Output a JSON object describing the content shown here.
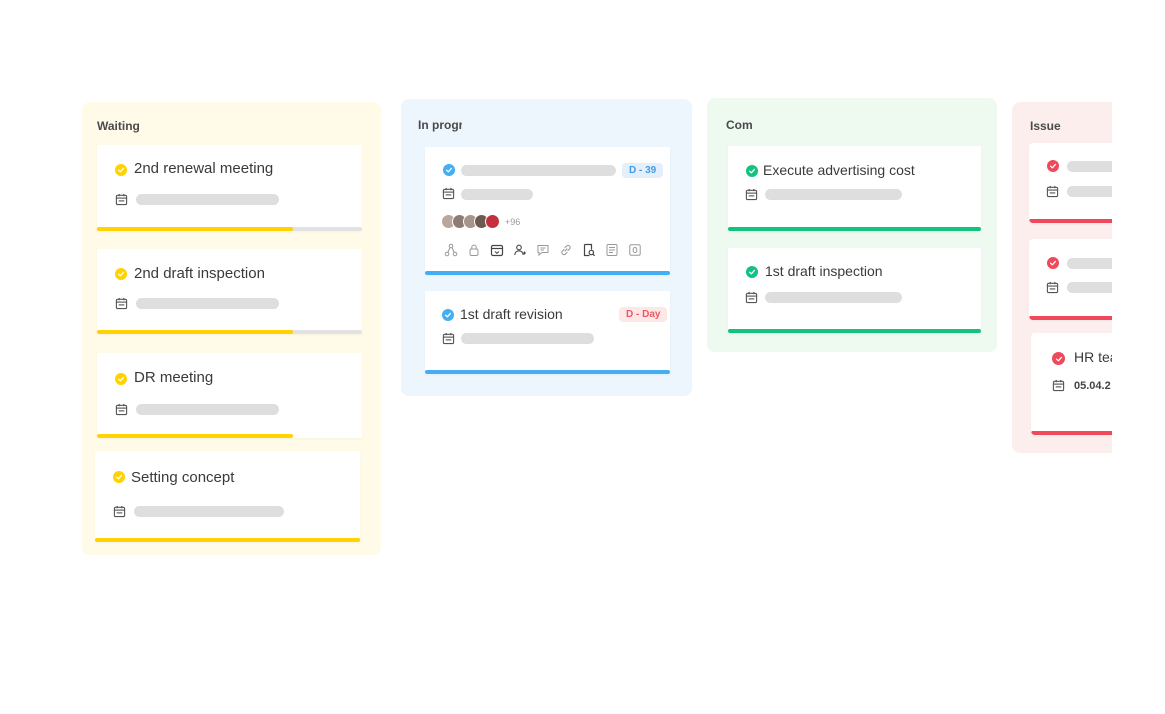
{
  "colors": {
    "yellow": "#ffd200",
    "blue": "#45aef2",
    "green": "#12c27e",
    "red": "#f0495b",
    "track": "#e2e2e2"
  },
  "columns": {
    "waiting": {
      "title": "Waiting",
      "cards": [
        {
          "title": "2nd renewal meeting",
          "progress": 0.74
        },
        {
          "title": "2nd draft inspection",
          "progress": 0.74
        },
        {
          "title": "DR meeting",
          "progress": 0.74
        },
        {
          "title": "Setting concept",
          "progress": 1.0
        }
      ]
    },
    "in_progress": {
      "title": "In progress",
      "cards": [
        {
          "badge": "D - 39",
          "more_members": "+96",
          "toolbar_icons": [
            "hierarchy-icon",
            "lock-icon",
            "calendar-icon",
            "assign-user-icon",
            "comment-icon",
            "link-icon",
            "search-doc-icon",
            "list-icon",
            "attachment-icon"
          ]
        },
        {
          "title": "1st draft revision",
          "badge": "D - Day"
        }
      ]
    },
    "complete": {
      "title": "Complete",
      "cards": [
        {
          "title": "Execute advertising cost"
        },
        {
          "title": "1st draft inspection"
        }
      ]
    },
    "issue": {
      "title": "Issue",
      "cards": [
        {},
        {},
        {
          "title": "HR team",
          "date": "05.04.2"
        }
      ]
    }
  }
}
